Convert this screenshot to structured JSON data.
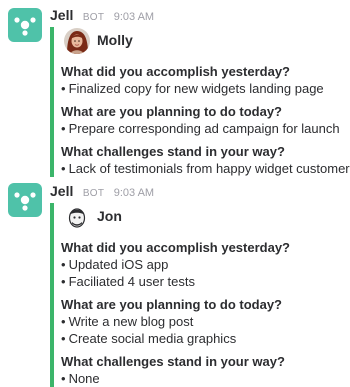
{
  "messages": [
    {
      "sender": "Jell",
      "badge": "BOT",
      "time": "9:03 AM",
      "icon": "jell-app-icon",
      "user": {
        "name": "Molly",
        "avatar": "molly-avatar"
      },
      "sections": [
        {
          "question": "What did you accomplish yesterday?",
          "answers": [
            "Finalized copy for new widgets landing page"
          ]
        },
        {
          "question": "What are you planning to do today?",
          "answers": [
            "Prepare corresponding ad campaign for launch"
          ]
        },
        {
          "question": "What challenges stand in your way?",
          "answers": [
            "Lack of testimonials from happy widget customers"
          ]
        }
      ]
    },
    {
      "sender": "Jell",
      "badge": "BOT",
      "time": "9:03 AM",
      "icon": "jell-app-icon",
      "user": {
        "name": "Jon",
        "avatar": "jon-avatar"
      },
      "sections": [
        {
          "question": "What did you accomplish yesterday?",
          "answers": [
            "Updated iOS app",
            "Faciliated 4 user tests"
          ]
        },
        {
          "question": "What are you planning to do today?",
          "answers": [
            "Write a new blog post",
            "Create social media graphics"
          ]
        },
        {
          "question": "What challenges stand in your way?",
          "answers": [
            "None"
          ]
        }
      ]
    }
  ],
  "bullet": "•",
  "colors": {
    "app_icon": "#4fc2a9",
    "attachment_bar": "#3bb56a",
    "text": "#2c2d30",
    "muted": "#9e9ea6"
  }
}
